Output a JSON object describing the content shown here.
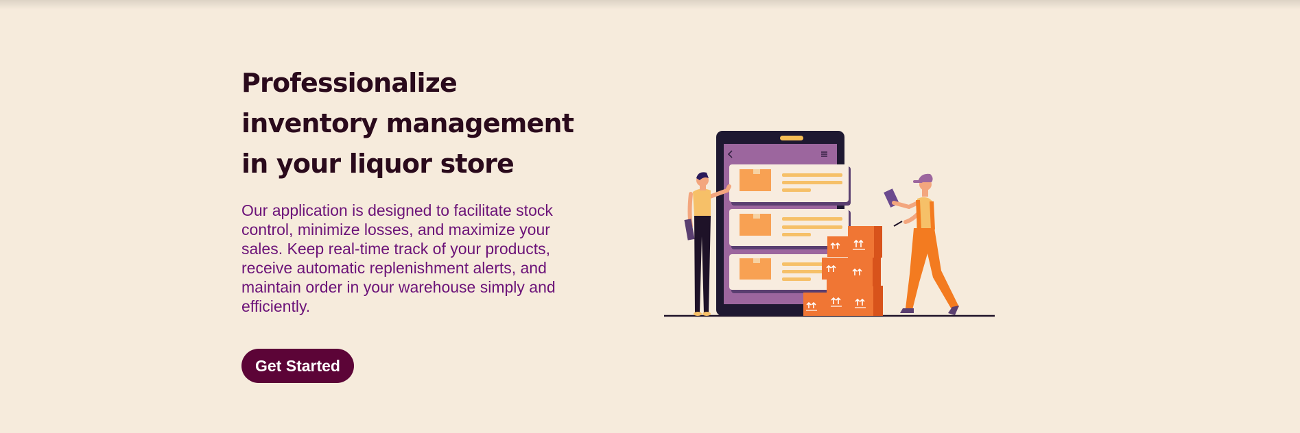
{
  "hero": {
    "title": "Professionalize inventory management in your liquor store",
    "description": "Our application is designed to facilitate stock control, minimize losses, and maximize your sales. Keep real-time track of your products, receive automatic replenishment alerts, and maintain order in your warehouse simply and efficiently.",
    "cta_label": "Get Started"
  },
  "colors": {
    "background": "#f6ebdc",
    "title": "#2a0a1c",
    "description": "#6b1278",
    "button": "#5c0437"
  },
  "illustration": {
    "icon": "inventory-illustration",
    "box_icon": "up-arrows-icon"
  }
}
